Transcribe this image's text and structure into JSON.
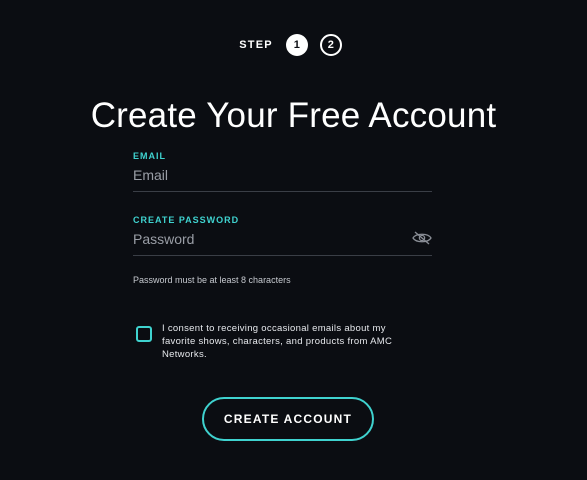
{
  "steps": {
    "label": "STEP",
    "items": [
      "1",
      "2"
    ],
    "active_index": 0
  },
  "title": "Create Your Free Account",
  "email": {
    "label": "EMAIL",
    "placeholder": "Email",
    "value": ""
  },
  "password": {
    "label": "CREATE PASSWORD",
    "placeholder": "Password",
    "value": "",
    "toggle_icon": "eye-slash-icon",
    "hint": "Password must be at least 8 characters"
  },
  "consent": {
    "checked": false,
    "text": "I consent to receiving occasional emails about my favorite shows, characters, and products from AMC Networks."
  },
  "submit": {
    "label": "CREATE ACCOUNT"
  },
  "colors": {
    "background": "#0b0d12",
    "accent": "#3fd2cf",
    "text": "#ffffff",
    "muted": "#9a9ea6"
  }
}
